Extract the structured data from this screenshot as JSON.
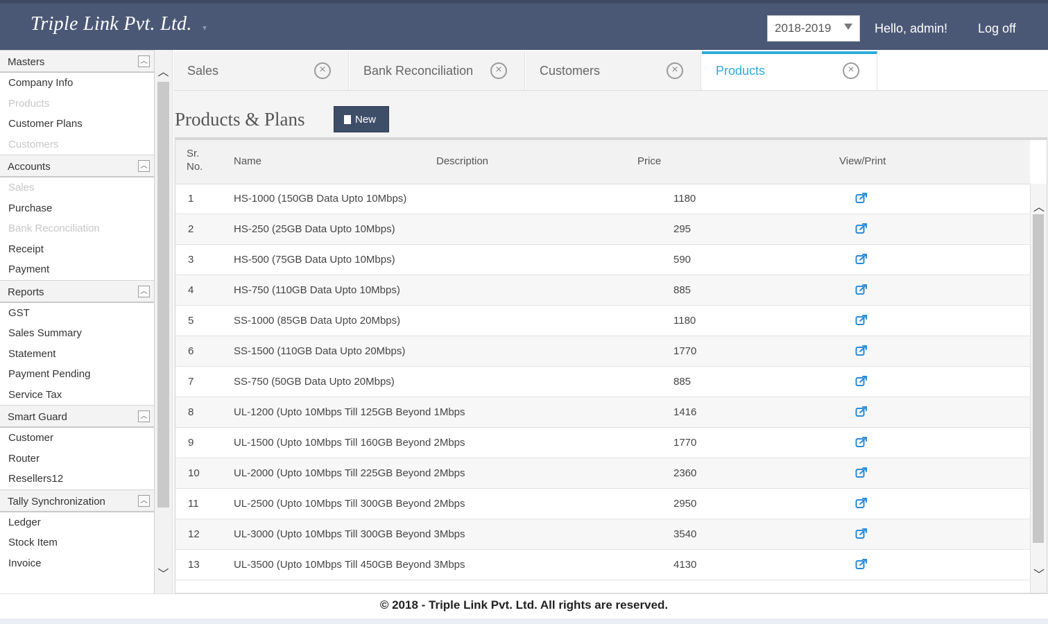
{
  "header": {
    "brand": "Triple Link Pvt. Ltd.",
    "year": "2018-2019",
    "greeting": "Hello, admin!",
    "logoff": "Log off"
  },
  "sidebar": {
    "sections": [
      {
        "title": "Masters",
        "items": [
          {
            "label": "Company Info",
            "disabled": false
          },
          {
            "label": "Products",
            "disabled": true
          },
          {
            "label": "Customer Plans",
            "disabled": false
          },
          {
            "label": "Customers",
            "disabled": true
          }
        ]
      },
      {
        "title": "Accounts",
        "items": [
          {
            "label": "Sales",
            "disabled": true
          },
          {
            "label": "Purchase",
            "disabled": false
          },
          {
            "label": "Bank Reconciliation",
            "disabled": true
          },
          {
            "label": "Receipt",
            "disabled": false
          },
          {
            "label": "Payment",
            "disabled": false
          }
        ]
      },
      {
        "title": "Reports",
        "items": [
          {
            "label": "GST",
            "disabled": false
          },
          {
            "label": "Sales Summary",
            "disabled": false
          },
          {
            "label": "Statement",
            "disabled": false
          },
          {
            "label": "Payment Pending",
            "disabled": false
          },
          {
            "label": "Service Tax",
            "disabled": false
          }
        ]
      },
      {
        "title": "Smart Guard",
        "items": [
          {
            "label": "Customer",
            "disabled": false
          },
          {
            "label": "Router",
            "disabled": false
          },
          {
            "label": "Resellers12",
            "disabled": false
          }
        ]
      },
      {
        "title": "Tally Synchronization",
        "items": [
          {
            "label": "Ledger",
            "disabled": false
          },
          {
            "label": "Stock Item",
            "disabled": false
          },
          {
            "label": "Invoice",
            "disabled": false
          }
        ]
      }
    ]
  },
  "tabs": [
    {
      "label": "Sales",
      "active": false
    },
    {
      "label": "Bank Reconciliation",
      "active": false
    },
    {
      "label": "Customers",
      "active": false
    },
    {
      "label": "Products",
      "active": true
    }
  ],
  "page": {
    "title": "Products & Plans",
    "new_label": "New"
  },
  "table": {
    "headers": {
      "sr_line1": "Sr.",
      "sr_line2": "No.",
      "name": "Name",
      "description": "Description",
      "price": "Price",
      "view": "View/Print"
    },
    "rows": [
      {
        "sr": "1",
        "name": "HS-1000 (150GB Data Upto 10Mbps)",
        "price": "1180"
      },
      {
        "sr": "2",
        "name": "HS-250 (25GB Data Upto 10Mbps)",
        "price": "295"
      },
      {
        "sr": "3",
        "name": "HS-500 (75GB Data Upto 10Mbps)",
        "price": "590"
      },
      {
        "sr": "4",
        "name": "HS-750 (110GB Data Upto 10Mbps)",
        "price": "885"
      },
      {
        "sr": "5",
        "name": "SS-1000 (85GB Data Upto 20Mbps)",
        "price": "1180"
      },
      {
        "sr": "6",
        "name": "SS-1500 (110GB Data Upto 20Mbps)",
        "price": "1770"
      },
      {
        "sr": "7",
        "name": "SS-750 (50GB Data Upto 20Mbps)",
        "price": "885"
      },
      {
        "sr": "8",
        "name": "UL-1200 (Upto 10Mbps Till 125GB Beyond 1Mbps",
        "price": "1416"
      },
      {
        "sr": "9",
        "name": "UL-1500 (Upto 10Mbps Till 160GB Beyond 2Mbps",
        "price": "1770"
      },
      {
        "sr": "10",
        "name": "UL-2000 (Upto 10Mbps Till 225GB Beyond 2Mbps",
        "price": "2360"
      },
      {
        "sr": "11",
        "name": "UL-2500 (Upto 10Mbps Till 300GB Beyond 2Mbps",
        "price": "2950"
      },
      {
        "sr": "12",
        "name": "UL-3000 (Upto 10Mbps Till 300GB Beyond 3Mbps",
        "price": "3540"
      },
      {
        "sr": "13",
        "name": "UL-3500 (Upto 10Mbps Till 450GB Beyond 3Mbps",
        "price": "4130"
      }
    ]
  },
  "footer": {
    "text": "© 2018 - Triple Link Pvt. Ltd. All rights are reserved."
  },
  "colors": {
    "header_bg": "#4b5875",
    "accent": "#2eaad8",
    "button_bg": "#3f4e68",
    "link_icon": "#2b8ad8"
  },
  "icons": {
    "close": "close-circle-icon",
    "edit": "edit-external-icon",
    "doc": "document-icon",
    "collapse": "chevron-up-icon"
  }
}
